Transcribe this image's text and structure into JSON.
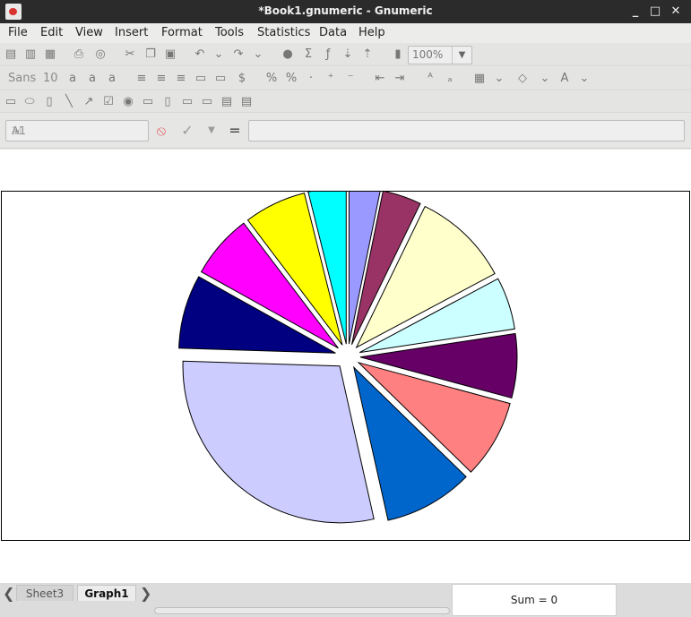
{
  "window": {
    "title": "*Book1.gnumeric - Gnumeric",
    "minimize": "_",
    "maximize": "□",
    "close": "✕"
  },
  "menu": [
    "File",
    "Edit",
    "View",
    "Insert",
    "Format",
    "Tools",
    "Statistics",
    "Data",
    "Help"
  ],
  "toolbar": {
    "zoom": "100%",
    "font_name": "Sans",
    "font_size": "10"
  },
  "formula_bar": {
    "cell_ref": "A1",
    "cancel_icon": "cancel-icon",
    "accept_icon": "check-icon",
    "equals": "=",
    "formula": ""
  },
  "chart_data": {
    "type": "pie",
    "exploded": true,
    "start_angle_deg": 0,
    "slices": [
      {
        "value": 3.2,
        "color": "#9999ff"
      },
      {
        "value": 4.0,
        "color": "#993366"
      },
      {
        "value": 10.0,
        "color": "#ffffcc"
      },
      {
        "value": 5.4,
        "color": "#ccffff"
      },
      {
        "value": 6.6,
        "color": "#660066"
      },
      {
        "value": 8.1,
        "color": "#ff8080"
      },
      {
        "value": 9.2,
        "color": "#0066cc"
      },
      {
        "value": 29.0,
        "color": "#ccccff"
      },
      {
        "value": 7.6,
        "color": "#000080"
      },
      {
        "value": 6.6,
        "color": "#ff00ff"
      },
      {
        "value": 6.4,
        "color": "#ffff00"
      },
      {
        "value": 3.9,
        "color": "#00ffff"
      }
    ]
  },
  "tabs": [
    {
      "label": "Sheet3",
      "active": false
    },
    {
      "label": "Graph1",
      "active": true
    }
  ],
  "status": {
    "sum": "Sum = 0"
  }
}
